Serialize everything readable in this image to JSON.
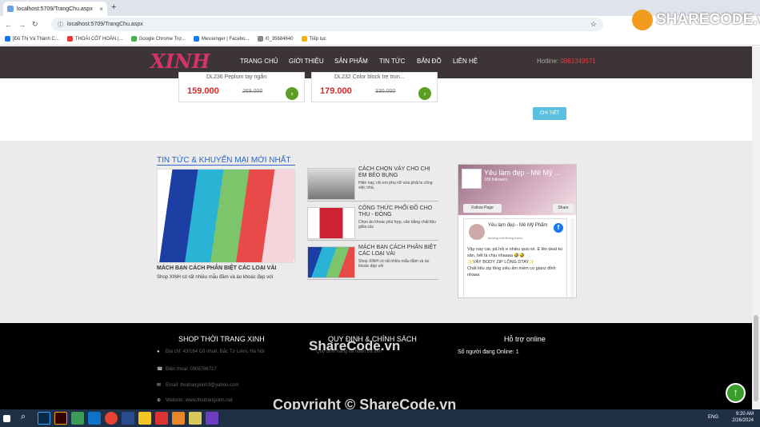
{
  "browser": {
    "tab_title": "localhost:5709/TrangChu.aspx",
    "url": "localhost:5709/TrangChu.aspx",
    "bookmarks": [
      "[Đồ Thị Và Thành C...",
      "THOÁI CỐT HOÀN |...",
      "Google Chrome Trợ...",
      "Messenger | Facebo...",
      "/0_35684640",
      "Tiếp tục"
    ]
  },
  "watermark": {
    "logo": "SHARECODE.vn",
    "center": "ShareCode.vn",
    "bottom": "Copyright © ShareCode.vn"
  },
  "nav": {
    "brand": "XINH",
    "items": [
      "TRANG CHỦ",
      "GIỚI THIỆU",
      "SẢN PHẨM",
      "TIN TỨC",
      "BẢN ĐỒ",
      "LIÊN HỆ"
    ],
    "hotline_label": "Hotline:",
    "hotline_number": "0981349571"
  },
  "products": [
    {
      "name": "DL236 Peplum tay ngắn",
      "price": "159.000",
      "old_price": "269.000"
    },
    {
      "name": "DL232 Color block tre trun...",
      "price": "179.000",
      "old_price": "330.000"
    }
  ],
  "detail_button": "CHI TIẾT",
  "news": {
    "section_title": "TIN TỨC & KHUYẾN MẠI MỚI NHẤT",
    "featured_title": "MÁCH BẠN CÁCH PHÂN BIỆT CÁC LOẠI VẢI",
    "featured_desc": "Shop XINH có rất nhiều mẫu đầm và áo khoác đẹp với",
    "items": [
      {
        "title": "CÁCH CHỌN VÁY CHO CHỊ EM BÉO BỤNG",
        "desc": "Hiện nay, chị em phụ nữ vừa phải lo công việc nhà,"
      },
      {
        "title": "CÔNG THỨC PHỐI ĐỒ CHO THU - ĐÔNG",
        "desc": "Chọn áo khoác phù hợp, cân bằng chất liệu giữa các"
      },
      {
        "title": "MÁCH BẠN CÁCH PHÂN BIỆT CÁC LOẠI VẢI",
        "desc": "Shop XINH có rất nhiều mẫu đầm và áo khoác đẹp với"
      }
    ]
  },
  "facebook": {
    "page_name": "Yêu làm đẹp - Mê Mỹ ...",
    "followers": "109 followers",
    "follow_btn": "Follow Page",
    "share_btn": "Share",
    "post_title": "Yêu làm đẹp - Mê Mỹ Phẩm",
    "post_time": "khoảng một tháng trước",
    "post_line1": "Vậy nay các pả hỏi e nhiều quá nè. E lên deal ko sân, hết là chịu nhaaaa 🤣🤣",
    "post_line2": "✨VÁY BODY ZIP LÔNG DTAY✨",
    "post_line3": "Chất liệu zip lông siêu ấm mềm co gianz đỉnh nhaaa"
  },
  "footer": {
    "col1_title": "SHOP THỜI TRANG XINH",
    "col2_title": "QUY ĐỊNH & CHÍNH SÁCH",
    "col3_title": "Hỗ trợ online",
    "address": "Địa chỉ: 43/164 Cổ nhuế, Bắc Từ Liêm, Hà Nội",
    "phone": "Điện thoại: 0908786717",
    "email": "Email: thoitrangxinh3@yahoo.com",
    "website": "Website: www.thoitrangxinh.net",
    "policy": "Quy định hàng và hoàn trả tiền",
    "online": "Số người đang Online: 1"
  },
  "taskbar": {
    "lang": "ENG",
    "time": "9:20 AM",
    "date": "2/26/2024"
  }
}
